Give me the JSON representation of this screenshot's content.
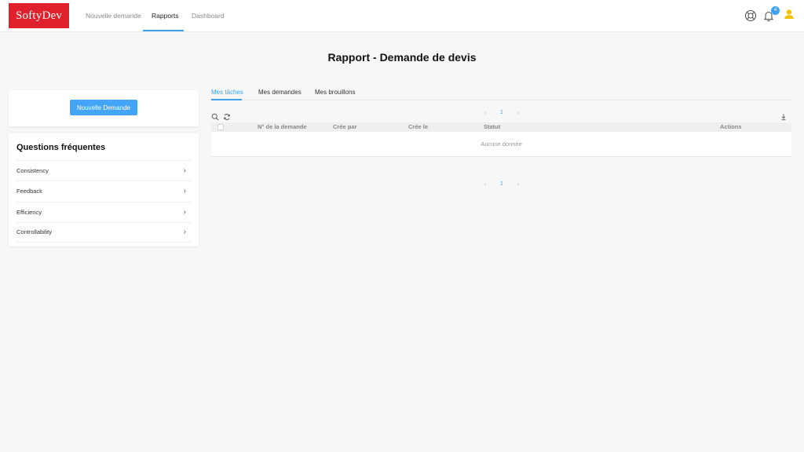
{
  "header": {
    "logo": "SoftyDev",
    "nav": [
      {
        "label": "Nouvelle demande"
      },
      {
        "label": "Rapports"
      },
      {
        "label": "Dashboard"
      }
    ],
    "notification_count": "4",
    "icons": [
      "lifebuoy-icon",
      "bell-icon",
      "user-icon"
    ],
    "colors": {
      "accent": "#3fa2f0",
      "logo_bg": "#e0202a",
      "user_icon": "#f2c200"
    }
  },
  "page": {
    "title": "Rapport - Demande de devis"
  },
  "sidebar": {
    "new_button": "Nouvelle Demande",
    "faq_title": "Questions fréquentes",
    "faq_items": [
      {
        "label": "Consistency"
      },
      {
        "label": "Feedback"
      },
      {
        "label": "Efficiency"
      },
      {
        "label": "Controllability"
      }
    ]
  },
  "tabs": [
    {
      "label": "Mes tâches"
    },
    {
      "label": "Mes demandes"
    },
    {
      "label": "Mes brouillons"
    }
  ],
  "pagination": {
    "page": "1",
    "prev": "‹",
    "next": "›"
  },
  "table": {
    "columns": [
      "N° de la demande",
      "Crée par",
      "Crée le",
      "Statut",
      "Actions"
    ],
    "empty_text": "Aucune donnée"
  }
}
